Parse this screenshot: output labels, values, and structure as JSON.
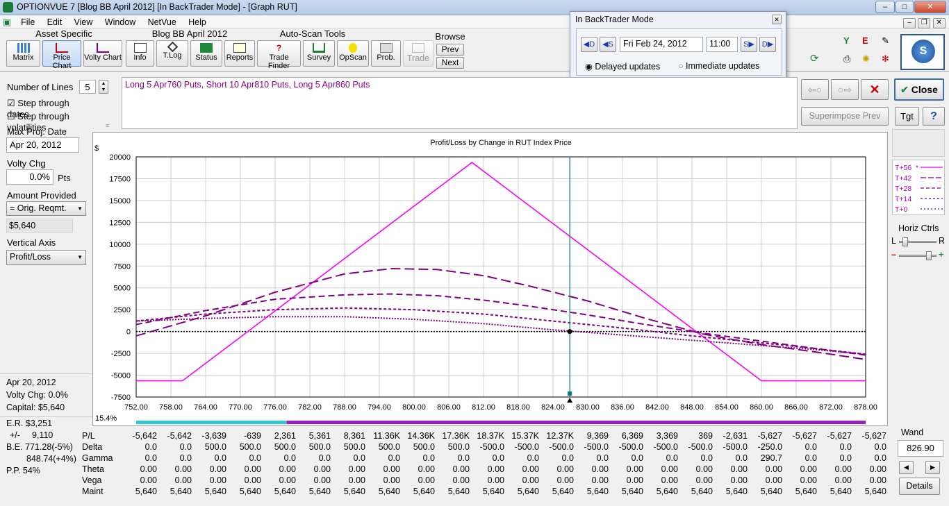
{
  "window": {
    "title": "OPTIONVUE 7    [Blog BB April 2012]    [In BackTrader Mode] - [Graph RUT]",
    "min": "–",
    "max": "□",
    "close": "✕"
  },
  "menu": [
    "File",
    "Edit",
    "View",
    "Window",
    "NetVue",
    "Help"
  ],
  "toolbar": {
    "groups": {
      "asset": "Asset Specific",
      "blog": "Blog BB April 2012",
      "autoscan": "Auto-Scan Tools",
      "browse": "Browse"
    },
    "buttons": [
      "Matrix",
      "Price Chart",
      "Volty Chart",
      "Info",
      "T.Log",
      "Status",
      "Reports",
      "Trade Finder",
      "Survey",
      "OpScan",
      "Prob.",
      "Trade"
    ],
    "prev": "Prev",
    "next": "Next"
  },
  "backtrader": {
    "title": "In BackTrader Mode",
    "date": "Fri Feb 24, 2012",
    "time": "11:00",
    "delayed": "Delayed updates",
    "immediate": "Immediate updates",
    "selected": "delayed"
  },
  "left": {
    "num_lines_label": "Number of Lines",
    "num_lines": "5",
    "step_dates": "Step through dates",
    "step_dates_checked": true,
    "step_vols": "Step through volatilities",
    "step_vols_checked": false,
    "max_proj_label": "Max Proj. Date",
    "max_proj": "Apr 20, 2012",
    "volty_label": "Volty Chg",
    "volty": "0.0%",
    "pts": "Pts",
    "amount_label": "Amount Provided",
    "amount_sel": "= Orig. Reqmt.",
    "amount": "$5,640",
    "vaxis_label": "Vertical Axis",
    "vaxis": "Profit/Loss"
  },
  "summary": {
    "date": "Apr 20, 2012",
    "volty": "Volty Chg:  0.0%",
    "capital": "Capital:  $5,640",
    "er": "E.R. $3,251",
    "pm_label": "+/-",
    "pm": "9,110",
    "be1": "B.E. 771.28(-5%)",
    "be2": "848.74(+4%)",
    "pp": "P.P.  54%"
  },
  "strategy": "Long 5 Apr760 Puts, Short 10 Apr810 Puts, Long 5 Apr860 Puts",
  "right": {
    "close": "Close",
    "superimpose": "Superimpose Prev",
    "tgt": "Tgt",
    "help": "?",
    "horiz": "Horiz Ctrls",
    "l": "L",
    "r": "R",
    "minus": "–",
    "plus": "+",
    "wand": "Wand",
    "wand_value": "826.90",
    "details": "Details"
  },
  "chart_data": {
    "type": "line",
    "title": "Profit/Loss by Change in RUT Index Price",
    "ylabel": "$",
    "ylim": [
      -7500,
      20000
    ],
    "xlim": [
      752,
      878
    ],
    "yticks": [
      "20000",
      "17500",
      "15000",
      "12500",
      "10000",
      "7500",
      "5000",
      "2500",
      "0",
      "-2500",
      "-5000",
      "-7500"
    ],
    "xticks": [
      "752.00",
      "758.00",
      "764.00",
      "770.00",
      "776.00",
      "782.00",
      "788.00",
      "794.00",
      "800.00",
      "806.00",
      "812.00",
      "818.00",
      "824.00",
      "830.00",
      "836.00",
      "842.00",
      "848.00",
      "854.00",
      "860.00",
      "866.00",
      "872.00",
      "878.00"
    ],
    "current_price": 826.9,
    "prob_label": "15.4%",
    "colors": {
      "t56": "#ff00ff",
      "tdash": "#800080",
      "zero": "#000000",
      "cursor": "#007a7a"
    },
    "series": [
      {
        "name": "T+56",
        "style": "solid",
        "x": [
          752,
          760,
          810,
          860,
          878
        ],
        "y": [
          -5640,
          -5640,
          19360,
          -5640,
          -5640
        ]
      },
      {
        "name": "T+42",
        "style": "longdash",
        "x": [
          752,
          764,
          776,
          788,
          796,
          804,
          812,
          820,
          830,
          840,
          850,
          860,
          870,
          878
        ],
        "y": [
          -500,
          1800,
          4500,
          6600,
          7200,
          7100,
          6400,
          5200,
          3500,
          1500,
          -300,
          -1500,
          -2400,
          -3200
        ]
      },
      {
        "name": "T+28",
        "style": "dash",
        "x": [
          752,
          764,
          776,
          788,
          796,
          804,
          812,
          820,
          830,
          840,
          850,
          860,
          870,
          878
        ],
        "y": [
          800,
          2400,
          3700,
          4200,
          4300,
          4100,
          3600,
          2900,
          1900,
          800,
          -200,
          -1100,
          -2000,
          -2700
        ]
      },
      {
        "name": "T+14",
        "style": "shortdash",
        "x": [
          752,
          764,
          776,
          788,
          800,
          812,
          824,
          836,
          848,
          860,
          870,
          878
        ],
        "y": [
          1200,
          2000,
          2500,
          2700,
          2500,
          2000,
          1200,
          400,
          -500,
          -1300,
          -2000,
          -2600
        ]
      },
      {
        "name": "T+0",
        "style": "dot",
        "x": [
          752,
          764,
          776,
          788,
          800,
          812,
          824,
          836,
          848,
          860,
          870,
          878
        ],
        "y": [
          1200,
          1500,
          1700,
          1700,
          1400,
          900,
          200,
          -400,
          -1000,
          -1600,
          -2100,
          -2600
        ]
      }
    ],
    "legend": [
      {
        "name": "T+56",
        "mark": "*"
      },
      {
        "name": "T+42",
        "mark": ""
      },
      {
        "name": "T+28",
        "mark": ""
      },
      {
        "name": "T+14",
        "mark": ""
      },
      {
        "name": "T+0",
        "mark": ""
      }
    ]
  },
  "table": {
    "rows": [
      {
        "label": "P/L",
        "values": [
          "-5,642",
          "-5,642",
          "-3,639",
          "-639",
          "2,361",
          "5,361",
          "8,361",
          "11.36K",
          "14.36K",
          "17.36K",
          "18.37K",
          "15.37K",
          "12.37K",
          "9,369",
          "6,369",
          "3,369",
          "369",
          "-2,631",
          "-5,627",
          "-5,627",
          "-5,627",
          "-5,627"
        ]
      },
      {
        "label": "Delta",
        "values": [
          "0.0",
          "0.0",
          "500.0",
          "500.0",
          "500.0",
          "500.0",
          "500.0",
          "500.0",
          "500.0",
          "500.0",
          "-500.0",
          "-500.0",
          "-500.0",
          "-500.0",
          "-500.0",
          "-500.0",
          "-500.0",
          "-500.0",
          "-250.0",
          "0.0",
          "0.0",
          "0.0"
        ]
      },
      {
        "label": "Gamma",
        "values": [
          "0.0",
          "0.0",
          "0.0",
          "0.0",
          "0.0",
          "0.0",
          "0.0",
          "0.0",
          "0.0",
          "0.0",
          "0.0",
          "0.0",
          "0.0",
          "0.0",
          "0.0",
          "0.0",
          "0.0",
          "0.0",
          "290.7",
          "0.0",
          "0.0",
          "0.0"
        ]
      },
      {
        "label": "Theta",
        "values": [
          "0.00",
          "0.00",
          "0.00",
          "0.00",
          "0.00",
          "0.00",
          "0.00",
          "0.00",
          "0.00",
          "0.00",
          "0.00",
          "0.00",
          "0.00",
          "0.00",
          "0.00",
          "0.00",
          "0.00",
          "0.00",
          "0.00",
          "0.00",
          "0.00",
          "0.00"
        ]
      },
      {
        "label": "Vega",
        "values": [
          "0.00",
          "0.00",
          "0.00",
          "0.00",
          "0.00",
          "0.00",
          "0.00",
          "0.00",
          "0.00",
          "0.00",
          "0.00",
          "0.00",
          "0.00",
          "0.00",
          "0.00",
          "0.00",
          "0.00",
          "0.00",
          "0.00",
          "0.00",
          "0.00",
          "0.00"
        ]
      },
      {
        "label": "Maint",
        "values": [
          "5,640",
          "5,640",
          "5,640",
          "5,640",
          "5,640",
          "5,640",
          "5,640",
          "5,640",
          "5,640",
          "5,640",
          "5,640",
          "5,640",
          "5,640",
          "5,640",
          "5,640",
          "5,640",
          "5,640",
          "5,640",
          "5,640",
          "5,640",
          "5,640",
          "5,640"
        ]
      }
    ]
  }
}
